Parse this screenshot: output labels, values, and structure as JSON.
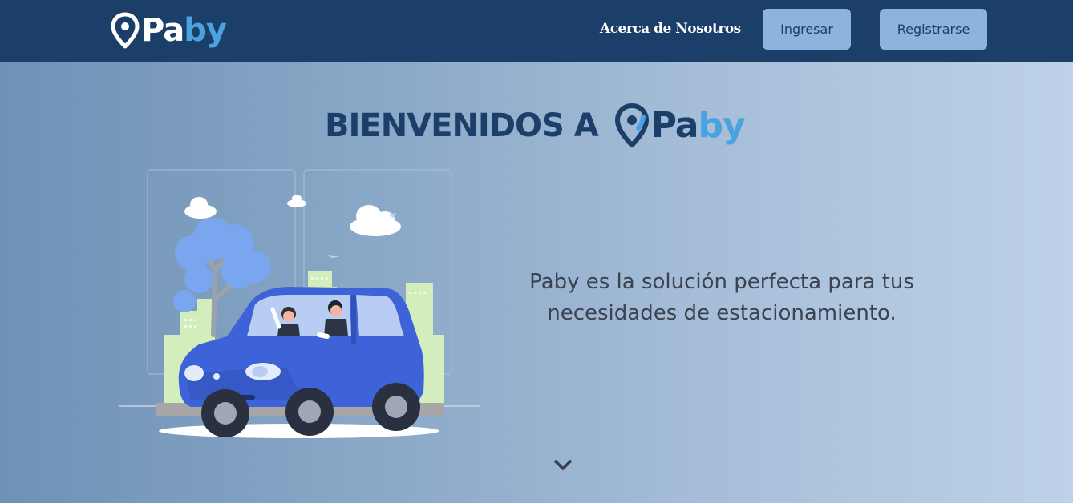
{
  "brand": {
    "name_part1": "Pa",
    "name_part2": "by",
    "pin_icon": "location-pin-icon"
  },
  "navbar": {
    "about_label": "Acerca de Nosotros",
    "login_label": "Ingresar",
    "register_label": "Registrarse"
  },
  "hero": {
    "title": "BIENVENIDOS A",
    "tagline_line1": "Paby es la solución perfecta para tus",
    "tagline_line2": "necesidades de estacionamiento.",
    "scroll_icon": "chevron-down-icon"
  },
  "colors": {
    "navbar_bg": "#1c3f69",
    "brand_blue": "#4aa3e0",
    "button_bg": "#8db3df",
    "car_blue": "#3e63d8"
  }
}
